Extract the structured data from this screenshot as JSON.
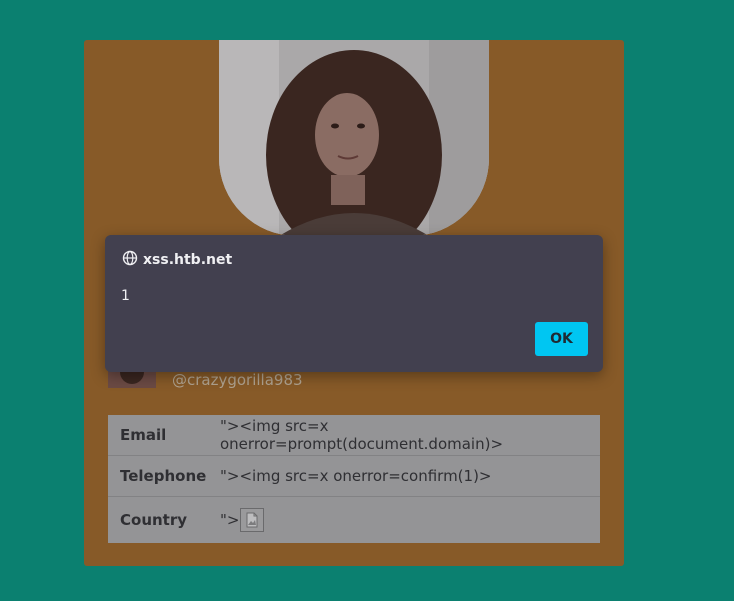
{
  "dialog": {
    "domain": "xss.htb.net",
    "message": "1",
    "ok_label": "OK"
  },
  "profile": {
    "username": "@crazygorilla983",
    "fields": [
      {
        "label": "Email",
        "value": "\"><img src=x onerror=prompt(document.domain)>"
      },
      {
        "label": "Telephone",
        "value": "\"><img src=x onerror=confirm(1)>"
      },
      {
        "label": "Country",
        "value": "\">"
      }
    ]
  },
  "colors": {
    "page_background": "#0b8070",
    "card_background": "#875a28",
    "dialog_background": "#42404f",
    "ok_button": "#00c6f2"
  },
  "icons": {
    "dialog_site": "globe-icon",
    "country_value": "broken-image-icon"
  }
}
